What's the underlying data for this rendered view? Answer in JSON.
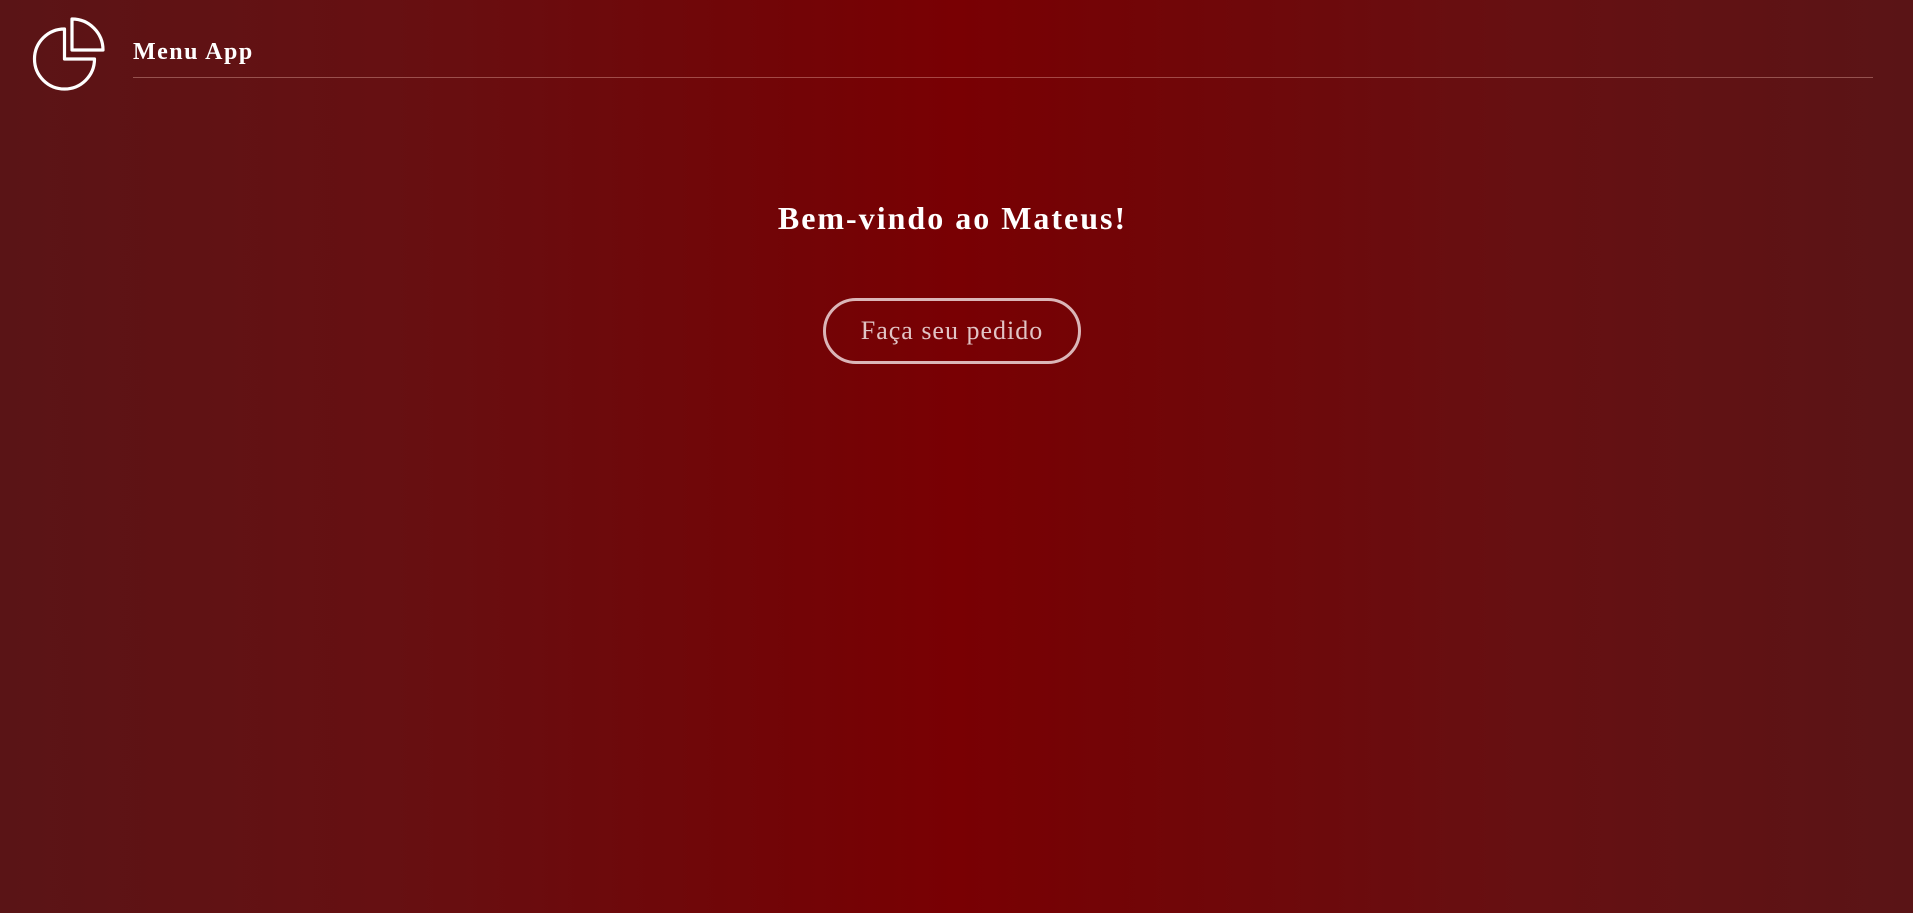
{
  "header": {
    "logo_icon": "pie-chart-icon",
    "app_title": "Menu App"
  },
  "main": {
    "welcome_text": "Bem-vindo ao Mateus!",
    "order_button_label": "Faça seu pedido"
  },
  "colors": {
    "background_center": "#790003",
    "background_edge": "#5a1416",
    "text": "#ffffff",
    "button_border": "#dbb6b8",
    "button_text": "#e1c4c5"
  }
}
